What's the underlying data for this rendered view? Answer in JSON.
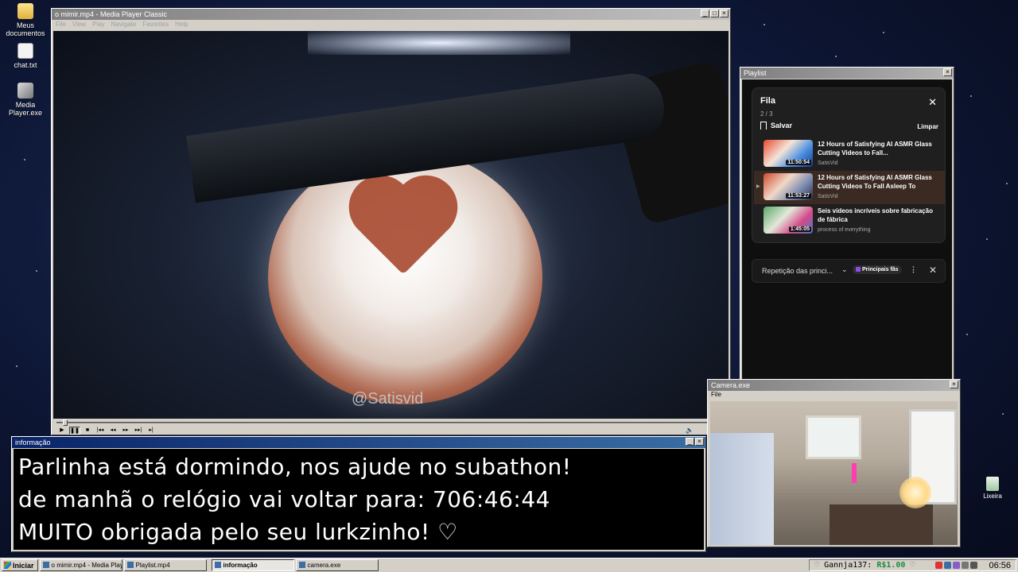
{
  "desktop_icons": [
    {
      "label": "Meus documentos"
    },
    {
      "label": "chat.txt"
    },
    {
      "label": "Media Player.exe"
    },
    {
      "label": "Lixeira"
    }
  ],
  "media_player": {
    "title": "o mimir.mp4 - Media Player Classic",
    "menu": [
      "File",
      "View",
      "Play",
      "Navigate",
      "Favorites",
      "Help"
    ],
    "watermark": "@Satisvid",
    "progress": 0.01
  },
  "playlist_window": {
    "title": "Playlist",
    "queue": {
      "title": "Fila",
      "count": "2 / 3",
      "save_label": "Salvar",
      "clear_label": "Limpar",
      "items": [
        {
          "title": "12 Hours of Satisfying AI ASMR Glass Cutting Videos to Fall...",
          "channel": "SatisVid",
          "duration": "11:50:54",
          "current": false
        },
        {
          "title": "12 Hours of Satisfying AI ASMR Glass Cutting Videos To Fall Asleep To",
          "channel": "SatisVid",
          "duration": "11:53:27",
          "current": true
        },
        {
          "title": "Seis vídeos incríveis sobre fabricação de fábrica",
          "channel": "process of everything",
          "duration": "1:45:05",
          "current": false
        }
      ]
    },
    "repeat": {
      "label": "Repetição das princi...",
      "badge": "Principais fãs"
    }
  },
  "info_window": {
    "title": "informação",
    "lines": [
      "Parlinha está dormindo, nos ajude no subathon!",
      "de manhã o relógio vai voltar para:  706:46:44",
      "MUITO obrigada pelo seu lurkzinho! ♡"
    ]
  },
  "camera_window": {
    "title": "Camera.exe",
    "menu": "File"
  },
  "taskbar": {
    "start_label": "Iniciar",
    "tasks": [
      {
        "label": "o mimir.mp4 - Media Player...",
        "active": false
      },
      {
        "label": "Playlist.mp4",
        "active": false
      },
      {
        "label": "informação",
        "active": true
      },
      {
        "label": "camera.exe",
        "active": false
      }
    ],
    "tray": {
      "left_heart": "♡",
      "user": "Gannja137:",
      "amount": "R$1.00",
      "right_heart": "♡"
    },
    "clock": "06:56"
  },
  "colors": {
    "title_active": "#0a246a",
    "window_face": "#d4d0c8",
    "money_green": "#1e8c3a",
    "queue_current_bg": "#3a2a22"
  }
}
